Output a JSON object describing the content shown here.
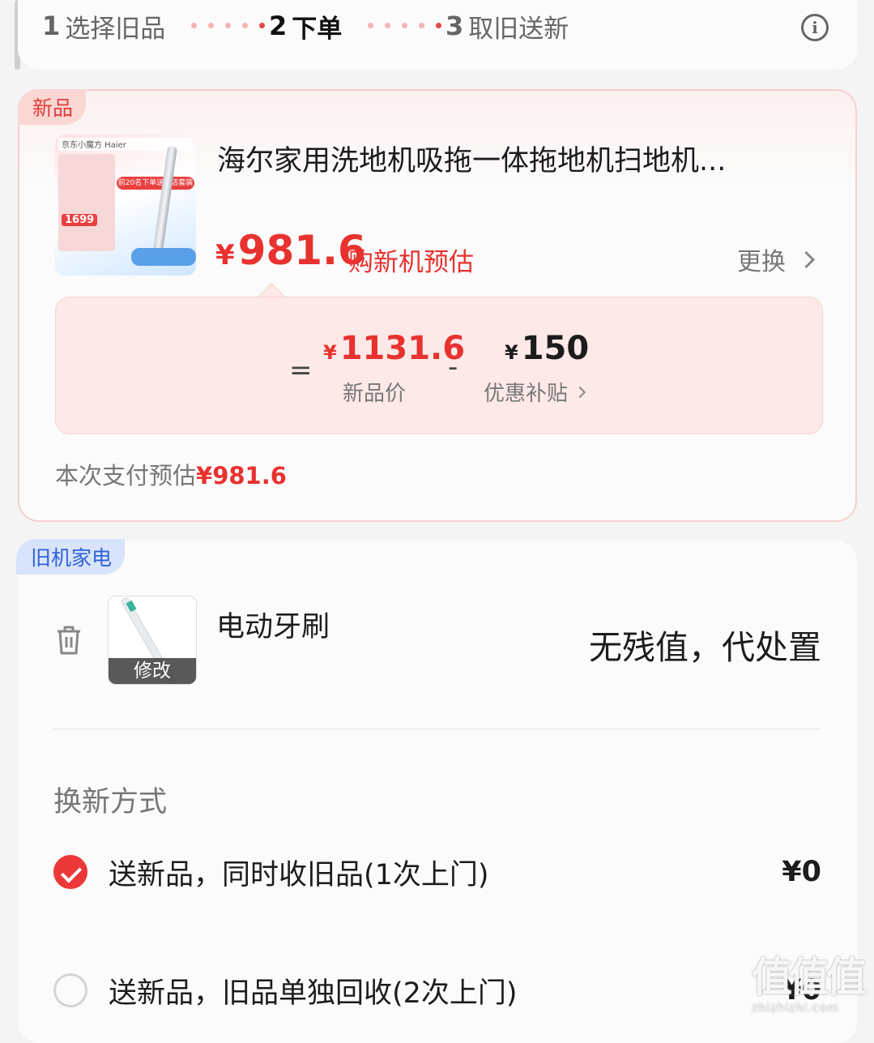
{
  "steps": [
    {
      "num": "1",
      "label": "选择旧品"
    },
    {
      "num": "2",
      "label": "下单"
    },
    {
      "num": "3",
      "label": "取旧送新"
    }
  ],
  "new_product": {
    "tag": "新品",
    "title": "海尔家用洗地机吸拖一体拖地机扫地机...",
    "image_text": {
      "brand": "京东小魔方 Haier",
      "price": "1699",
      "banner": "前20名下单送清洁套装"
    },
    "price_symbol": "¥",
    "price": "981.6",
    "price_note": "购新机预估",
    "change_label": "更换",
    "calc": {
      "equals": "=",
      "new_price_symbol": "¥",
      "new_price": "1131.6",
      "new_price_label": "新品价",
      "minus": "-",
      "subsidy_symbol": "¥",
      "subsidy": "150",
      "subsidy_label": "优惠补贴"
    },
    "pay_estimate_label": "本次支付预估",
    "pay_estimate_value": "¥981.6"
  },
  "old_item": {
    "tag": "旧机家电",
    "name": "电动牙刷",
    "edit_label": "修改",
    "value_text": "无残值，代处置"
  },
  "exchange": {
    "title": "换新方式",
    "options": [
      {
        "label": "送新品，同时收旧品(1次上门)",
        "price": "¥0",
        "checked": true
      },
      {
        "label": "送新品，旧品单独回收(2次上门)",
        "price": "¥0",
        "checked": false
      }
    ]
  },
  "watermark": {
    "main": "值值值",
    "sub": "zhizhizhi.com"
  },
  "colors": {
    "accent_red": "#e8322f",
    "old_tag_blue": "#2f61d6"
  }
}
